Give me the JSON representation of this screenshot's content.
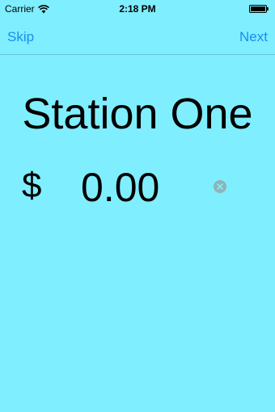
{
  "status_bar": {
    "carrier": "Carrier",
    "time": "2:18 PM",
    "wifi_icon": "wifi-icon",
    "battery_icon": "battery-icon"
  },
  "nav": {
    "skip_label": "Skip",
    "next_label": "Next"
  },
  "station": {
    "title": "Station One",
    "currency_symbol": "$",
    "amount_value": "0.00",
    "clear_icon": "clear-icon"
  },
  "colors": {
    "background": "#7feeff",
    "tint": "#1a8cf0",
    "clear_button": "#8fb3b8"
  }
}
